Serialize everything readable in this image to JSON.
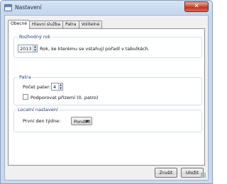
{
  "window": {
    "title": "Nastavení",
    "close_label": "✕"
  },
  "tabs": [
    {
      "label": "Obecné",
      "active": true
    },
    {
      "label": "Hlavní služba",
      "active": false
    },
    {
      "label": "Patra",
      "active": false
    },
    {
      "label": "Volitelné",
      "active": false
    }
  ],
  "section_year": {
    "title": "Rozhodný rok",
    "year_value": "2013",
    "description": "Rok, ke kterému se vstahují pořadí v tabulkách."
  },
  "section_floors": {
    "title": "Patra",
    "count_label": "Počet pater:",
    "count_value": "4",
    "ground_floor_label": "Podporovat přízemí (0. patro)",
    "ground_floor_checked": false
  },
  "section_locale": {
    "title": "Localní nastavení",
    "first_day_label": "První den týdne:",
    "first_day_value": "Pondělí"
  },
  "buttons": {
    "cancel": "Zrušit",
    "save": "Uložit"
  },
  "colors": {
    "group_title": "#1f3d70",
    "close_button": "#c9523d"
  }
}
